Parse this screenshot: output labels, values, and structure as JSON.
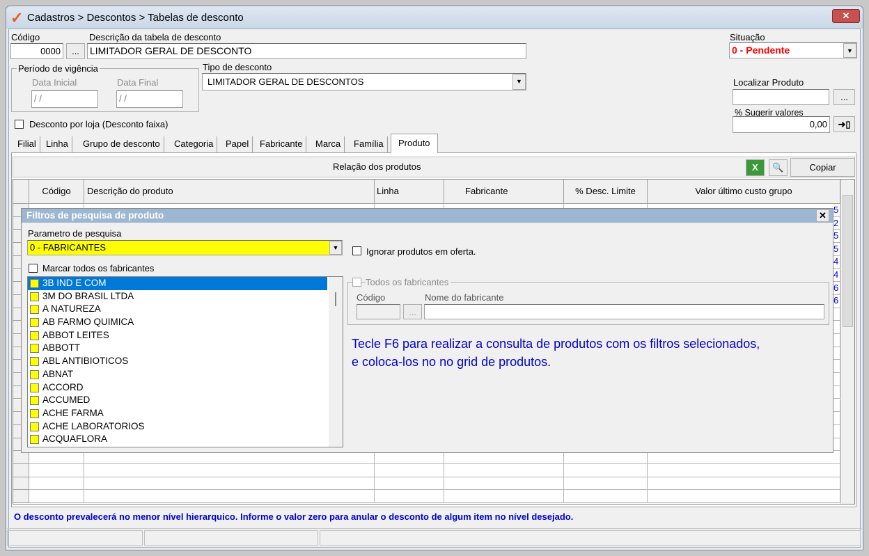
{
  "title": "Cadastros > Descontos > Tabelas de desconto",
  "form": {
    "codigo_label": "Código",
    "codigo": "0000",
    "browse": "...",
    "descricao_label": "Descrição da tabela de desconto",
    "descricao": "LIMITADOR GERAL DE DESCONTO",
    "periodo_label": "Período de vigência",
    "data_inicial_label": "Data Inicial",
    "data_inicial": " / /",
    "data_final_label": "Data Final",
    "data_final": " / /",
    "tipo_label": "Tipo de desconto",
    "tipo": "LIMITADOR GERAL DE DESCONTOS",
    "situacao_label": "Situação",
    "situacao": "0 - Pendente",
    "localizar_label": "Localizar Produto",
    "localizar": "",
    "sugerir_label": "% Sugerir valores",
    "sugerir": "0,00",
    "desconto_loja": "Desconto por loja (Desconto faixa)"
  },
  "tabs": [
    "Filial",
    "Linha",
    "Grupo de desconto",
    "Categoria",
    "Papel",
    "Fabricante",
    "Marca",
    "Família",
    "Produto"
  ],
  "grid": {
    "title": "Relação dos produtos",
    "copy": "Copiar",
    "columns": [
      "Código",
      "Descrição do produto",
      "Linha",
      "Fabricante",
      "% Desc. Limite",
      "Valor último custo grupo"
    ],
    "edge_digits": [
      "5",
      "2",
      "5",
      "5",
      "4",
      "4",
      "6",
      "6"
    ]
  },
  "dialog": {
    "title": "Filtros de pesquisa de produto",
    "param_label": "Parametro de pesquisa",
    "param": "0 - FABRICANTES",
    "marcar_todos": "Marcar todos os fabricantes",
    "ignorar": "Ignorar produtos em oferta.",
    "todos_fab": "Todos os fabricantes",
    "codigo_label": "Código",
    "nome_label": "Nome do fabricante",
    "hint": "Tecle F6 para realizar a consulta de produtos com os filtros selecionados, e coloca-los no no grid de produtos.",
    "items": [
      "3B IND E COM",
      "3M DO BRASIL LTDA",
      "A NATUREZA",
      "AB FARMO QUIMICA",
      "ABBOT LEITES",
      "ABBOTT",
      "ABL ANTIBIOTICOS",
      "ABNAT",
      "ACCORD",
      "ACCUMED",
      "ACHE FARMA",
      "ACHE LABORATORIOS",
      "ACQUAFLORA"
    ]
  },
  "footer": "O desconto prevalecerá no menor nível hierarquico. Informe o valor zero para anular o desconto de algum item no nível desejado.",
  "colors": {
    "accent": "#0000cc",
    "status": "#ff0000",
    "highlight": "#ffff00"
  }
}
